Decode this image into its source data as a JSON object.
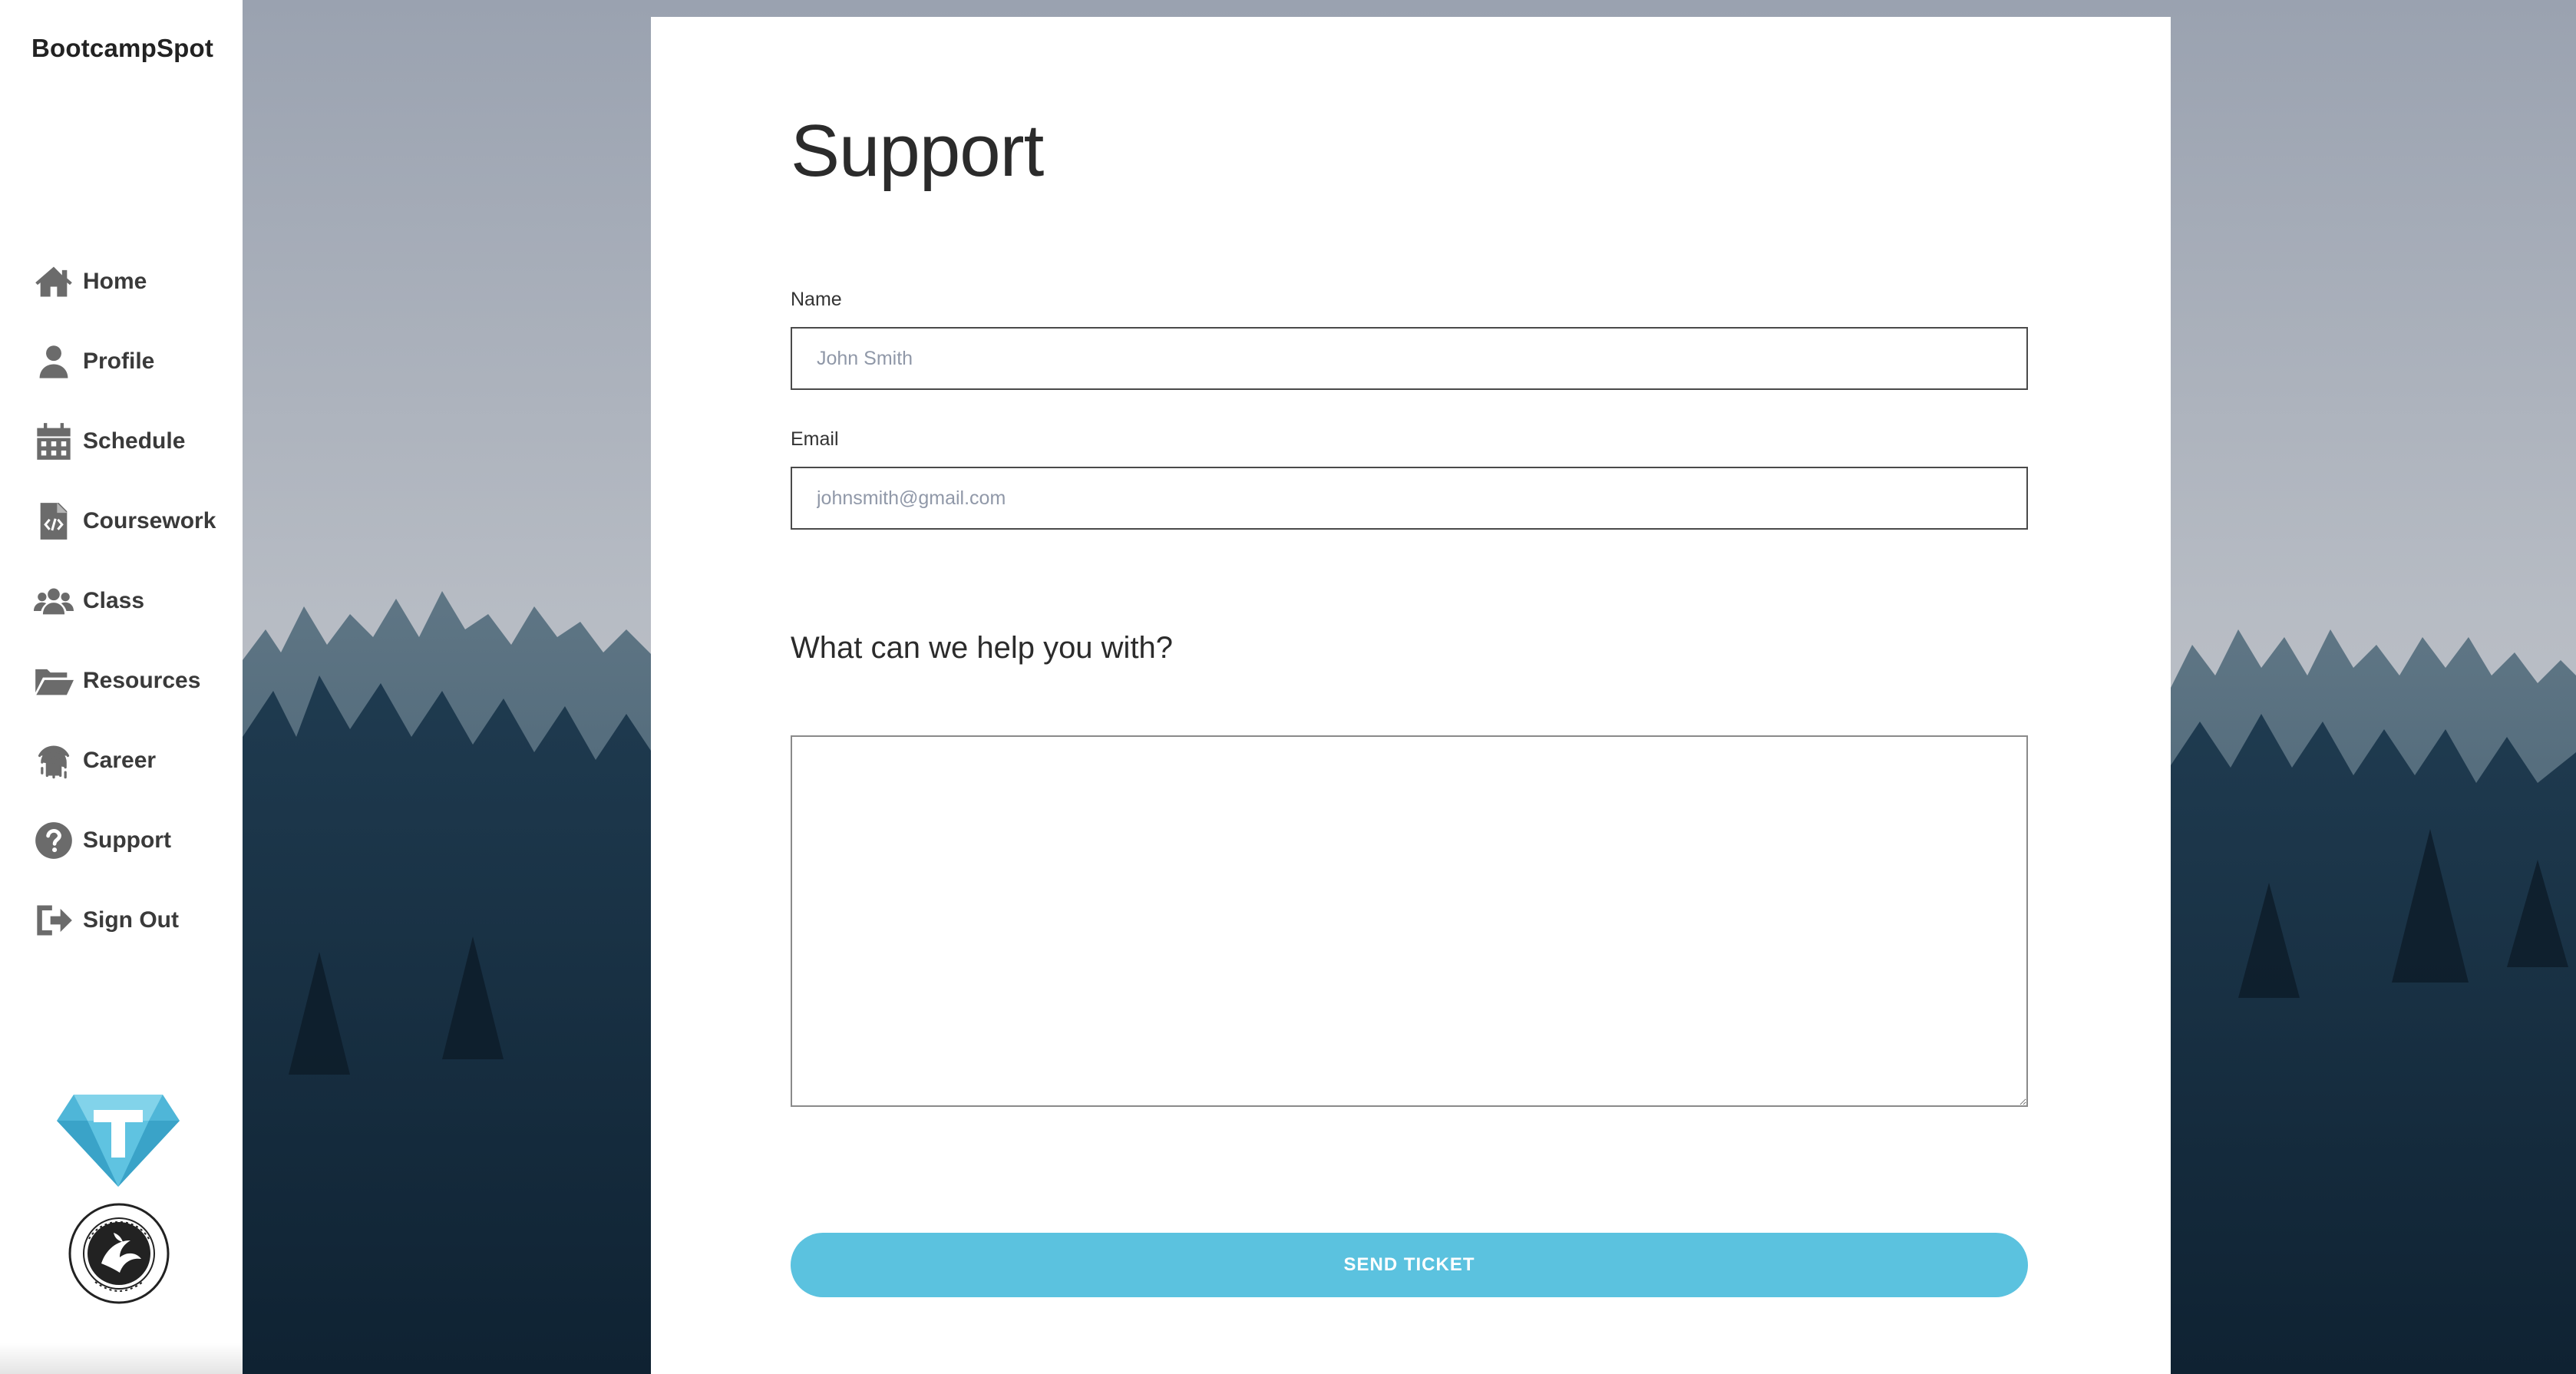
{
  "sidebar": {
    "brand": "BootcampSpot",
    "items": [
      {
        "label": "Home",
        "icon": "home-icon"
      },
      {
        "label": "Profile",
        "icon": "user-icon"
      },
      {
        "label": "Schedule",
        "icon": "calendar-icon"
      },
      {
        "label": "Coursework",
        "icon": "code-file-icon"
      },
      {
        "label": "Class",
        "icon": "users-icon"
      },
      {
        "label": "Resources",
        "icon": "folder-open-icon"
      },
      {
        "label": "Career",
        "icon": "fingerprint-icon"
      },
      {
        "label": "Support",
        "icon": "question-circle-icon"
      },
      {
        "label": "Sign Out",
        "icon": "sign-out-icon"
      }
    ],
    "logos": [
      "trilogy-t-logo",
      "university-of-central-florida-seal"
    ]
  },
  "main": {
    "title": "Support",
    "name_field": {
      "label": "Name",
      "placeholder": "John Smith"
    },
    "email_field": {
      "label": "Email",
      "placeholder": "johnsmith@gmail.com"
    },
    "message_prompt": "What can we help you with?",
    "submit_label": "SEND TICKET"
  },
  "colors": {
    "accent": "#5bc2df",
    "nav_icon": "#6b6b6b",
    "sky": "#9aa3b0",
    "forest": "#1f3a4e"
  }
}
